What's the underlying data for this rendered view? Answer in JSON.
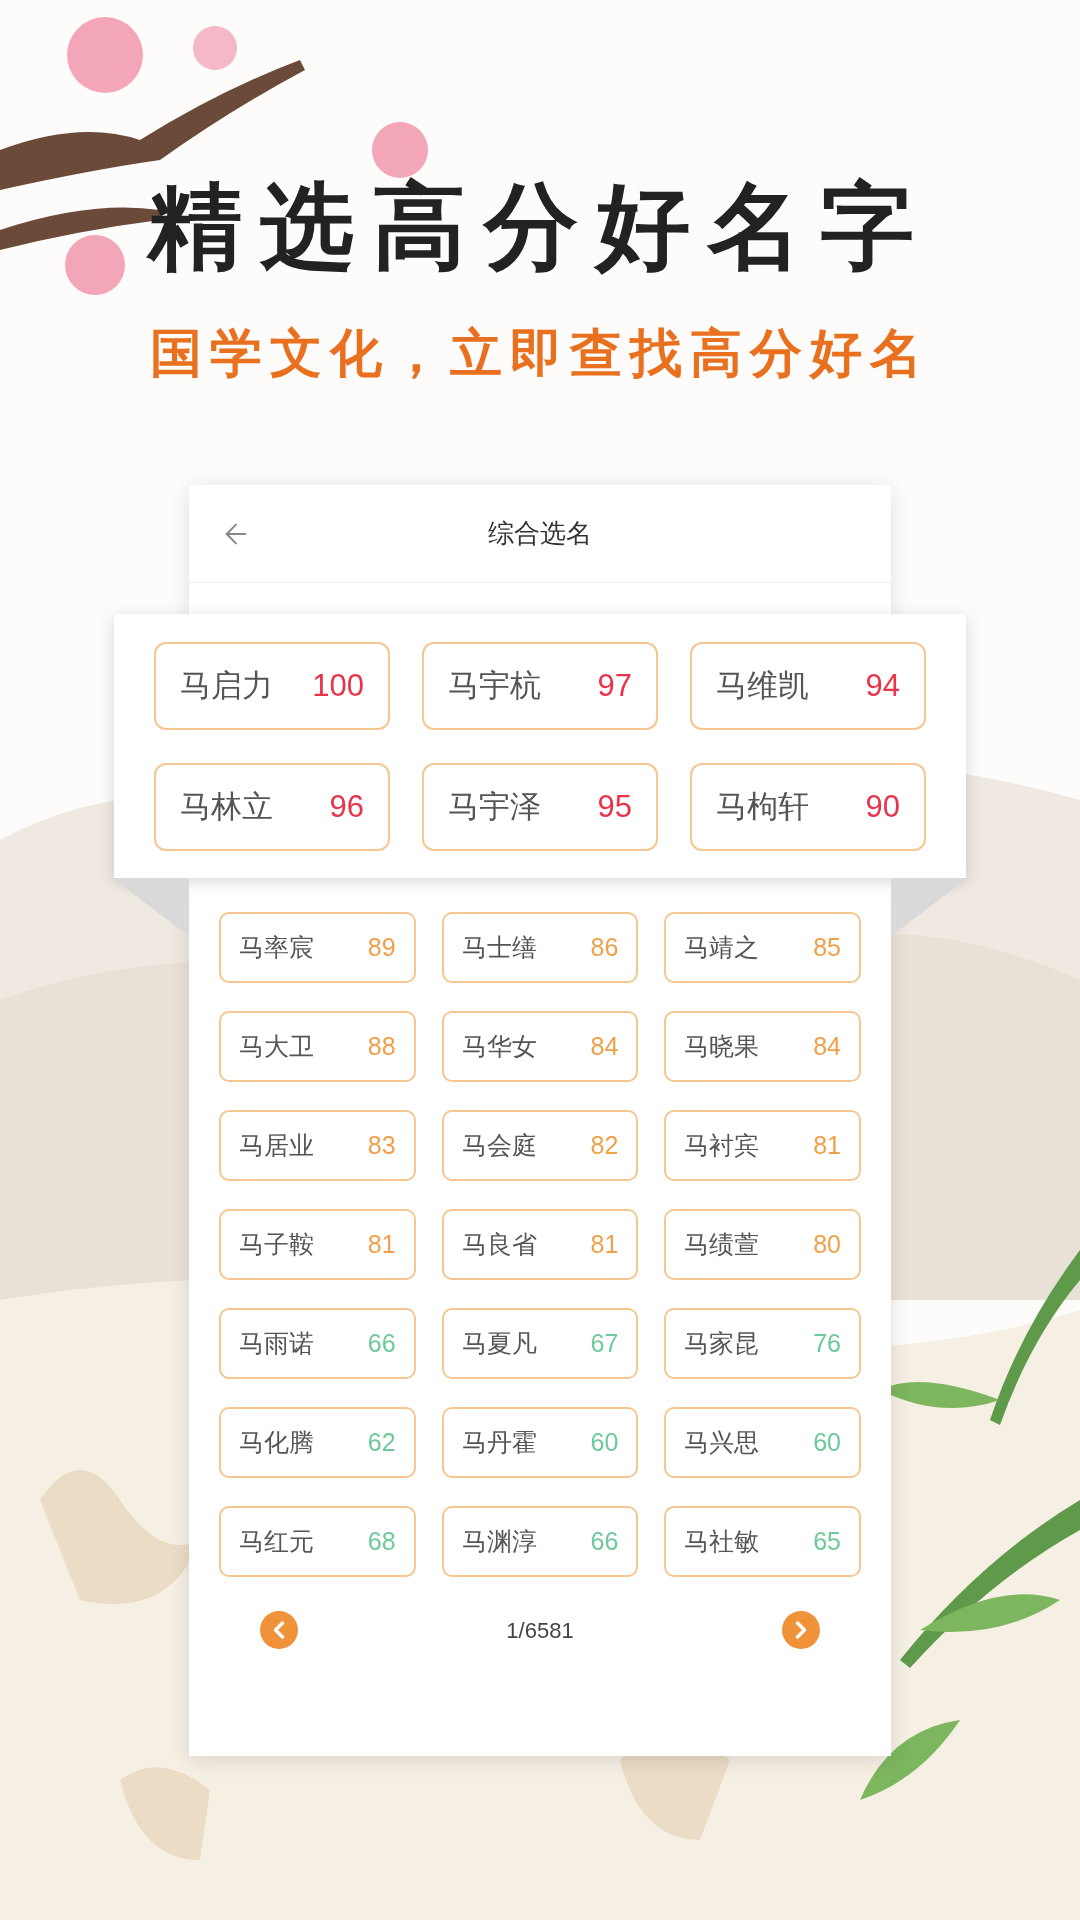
{
  "headline": "精选高分好名字",
  "subtitle": "国学文化，立即查找高分好名",
  "screen": {
    "title": "综合选名",
    "featured": [
      {
        "name": "马启力",
        "score": "100",
        "color": "#e8334a"
      },
      {
        "name": "马宇杭",
        "score": "97",
        "color": "#e8334a"
      },
      {
        "name": "马维凯",
        "score": "94",
        "color": "#e8334a"
      },
      {
        "name": "马林立",
        "score": "96",
        "color": "#e8334a"
      },
      {
        "name": "马宇泽",
        "score": "95",
        "color": "#e8334a"
      },
      {
        "name": "马枸轩",
        "score": "90",
        "color": "#e8334a"
      }
    ],
    "names": [
      {
        "name": "马率宸",
        "score": "89",
        "color": "#f0a048"
      },
      {
        "name": "马士缮",
        "score": "86",
        "color": "#f0a048"
      },
      {
        "name": "马靖之",
        "score": "85",
        "color": "#f0a048"
      },
      {
        "name": "马大卫",
        "score": "88",
        "color": "#f0a048"
      },
      {
        "name": "马华女",
        "score": "84",
        "color": "#f0a048"
      },
      {
        "name": "马晓果",
        "score": "84",
        "color": "#f0a048"
      },
      {
        "name": "马居业",
        "score": "83",
        "color": "#f0a048"
      },
      {
        "name": "马会庭",
        "score": "82",
        "color": "#f0a048"
      },
      {
        "name": "马衬宾",
        "score": "81",
        "color": "#f0a048"
      },
      {
        "name": "马子鞍",
        "score": "81",
        "color": "#f0a048"
      },
      {
        "name": "马良省",
        "score": "81",
        "color": "#f0a048"
      },
      {
        "name": "马绩萱",
        "score": "80",
        "color": "#f0a048"
      },
      {
        "name": "马雨诺",
        "score": "66",
        "color": "#6cc99a"
      },
      {
        "name": "马夏凡",
        "score": "67",
        "color": "#6cc99a"
      },
      {
        "name": "马家昆",
        "score": "76",
        "color": "#6cc99a"
      },
      {
        "name": "马化腾",
        "score": "62",
        "color": "#6cc99a"
      },
      {
        "name": "马丹霍",
        "score": "60",
        "color": "#6cc99a"
      },
      {
        "name": "马兴思",
        "score": "60",
        "color": "#6cc99a"
      },
      {
        "name": "马红元",
        "score": "68",
        "color": "#6cc99a"
      },
      {
        "name": "马渊淳",
        "score": "66",
        "color": "#6cc99a"
      },
      {
        "name": "马社敏",
        "score": "65",
        "color": "#6cc99a"
      }
    ],
    "pager": "1/6581"
  }
}
